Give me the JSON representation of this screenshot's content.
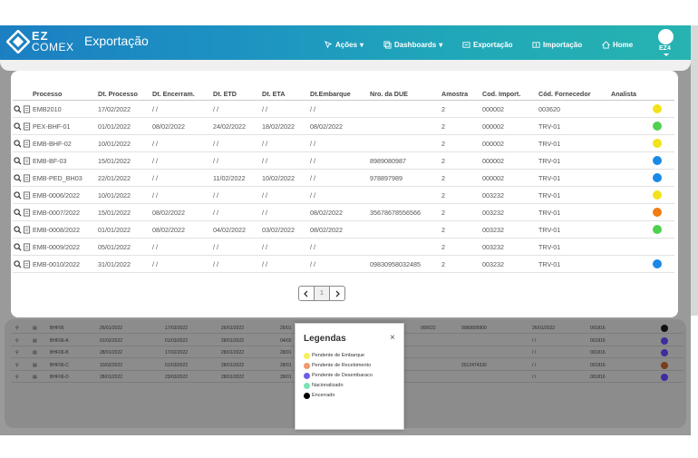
{
  "header": {
    "logo_line1": "EZ",
    "logo_line2": "COMEX",
    "title": "Exportação",
    "nav": [
      {
        "label": "Ações",
        "icon": "cursor-icon",
        "dropdown": true
      },
      {
        "label": "Dashboards",
        "icon": "copy-icon",
        "dropdown": true
      },
      {
        "label": "Exportação",
        "icon": "export-icon",
        "dropdown": false
      },
      {
        "label": "Importação",
        "icon": "import-icon",
        "dropdown": false
      },
      {
        "label": "Home",
        "icon": "home-icon",
        "dropdown": false
      }
    ],
    "user_label": "EZ4"
  },
  "table": {
    "columns": [
      "Processo",
      "Dt. Processo",
      "Dt. Encerram.",
      "Dt. ETD",
      "Dt. ETA",
      "Dt.Embarque",
      "Nro. da DUE",
      "Amostra",
      "Cod. Import.",
      "Cód. Fornecedor",
      "Analista"
    ],
    "rows": [
      {
        "processo": "EMB2010",
        "dt_processo": "17/02/2022",
        "dt_encerram": "/ /",
        "dt_etd": "/ /",
        "dt_eta": "/ /",
        "dt_embarque": "/ /",
        "nro_due": "",
        "amostra": "2",
        "cod_import": "000002",
        "cod_fornecedor": "003620",
        "analista": "",
        "status_color": "#f2e21c"
      },
      {
        "processo": "PEX-BHF-01",
        "dt_processo": "01/01/2022",
        "dt_encerram": "08/02/2022",
        "dt_etd": "24/02/2022",
        "dt_eta": "18/02/2022",
        "dt_embarque": "08/02/2022",
        "nro_due": "",
        "amostra": "2",
        "cod_import": "000002",
        "cod_fornecedor": "TRV-01",
        "analista": "",
        "status_color": "#4fd14f"
      },
      {
        "processo": "EMB-BHF-02",
        "dt_processo": "10/01/2022",
        "dt_encerram": "/ /",
        "dt_etd": "/ /",
        "dt_eta": "/ /",
        "dt_embarque": "/ /",
        "nro_due": "",
        "amostra": "2",
        "cod_import": "000002",
        "cod_fornecedor": "TRV-01",
        "analista": "",
        "status_color": "#f2e21c"
      },
      {
        "processo": "EMB-BF-03",
        "dt_processo": "15/01/2022",
        "dt_encerram": "/ /",
        "dt_etd": "/ /",
        "dt_eta": "/ /",
        "dt_embarque": "/ /",
        "nro_due": "8989080987",
        "amostra": "2",
        "cod_import": "000002",
        "cod_fornecedor": "TRV-01",
        "analista": "",
        "status_color": "#1a8ae6"
      },
      {
        "processo": "EMB-PED_BH03",
        "dt_processo": "22/01/2022",
        "dt_encerram": "/ /",
        "dt_etd": "11/02/2022",
        "dt_eta": "10/02/2022",
        "dt_embarque": "/ /",
        "nro_due": "978897989",
        "amostra": "2",
        "cod_import": "000002",
        "cod_fornecedor": "TRV-01",
        "analista": "",
        "status_color": "#1a8ae6"
      },
      {
        "processo": "EMB-0006/2022",
        "dt_processo": "10/01/2022",
        "dt_encerram": "/ /",
        "dt_etd": "/ /",
        "dt_eta": "/ /",
        "dt_embarque": "/ /",
        "nro_due": "",
        "amostra": "2",
        "cod_import": "003232",
        "cod_fornecedor": "TRV-01",
        "analista": "",
        "status_color": "#f2e21c"
      },
      {
        "processo": "EMB-0007/2022",
        "dt_processo": "15/01/2022",
        "dt_encerram": "08/02/2022",
        "dt_etd": "/ /",
        "dt_eta": "/ /",
        "dt_embarque": "08/02/2022",
        "nro_due": "35678678556566",
        "amostra": "2",
        "cod_import": "003232",
        "cod_fornecedor": "TRV-01",
        "analista": "",
        "status_color": "#f27d12"
      },
      {
        "processo": "EMB-0008/2022",
        "dt_processo": "01/01/2022",
        "dt_encerram": "08/02/2022",
        "dt_etd": "04/02/2022",
        "dt_eta": "03/02/2022",
        "dt_embarque": "08/02/2022",
        "nro_due": "",
        "amostra": "2",
        "cod_import": "003232",
        "cod_fornecedor": "TRV-01",
        "analista": "",
        "status_color": "#4fd14f"
      },
      {
        "processo": "EMB-0009/2022",
        "dt_processo": "05/01/2022",
        "dt_encerram": "/ /",
        "dt_etd": "/ /",
        "dt_eta": "/ /",
        "dt_embarque": "/ /",
        "nro_due": "",
        "amostra": "2",
        "cod_import": "003232",
        "cod_fornecedor": "TRV-01",
        "analista": "",
        "status_color": ""
      },
      {
        "processo": "EMB-0010/2022",
        "dt_processo": "31/01/2022",
        "dt_encerram": "/ /",
        "dt_etd": "/ /",
        "dt_eta": "/ /",
        "dt_embarque": "/ /",
        "nro_due": "09830958032485",
        "amostra": "2",
        "cod_import": "003232",
        "cod_fornecedor": "TRV-01",
        "analista": "",
        "status_color": "#1a8ae6"
      }
    ]
  },
  "pagination": {
    "current_page": "1"
  },
  "background_rows": [
    {
      "processo": "BHF05",
      "dt_processo": "26/01/2022",
      "dt_encerram": "17/03/2022",
      "dt_etd": "26/01/2022",
      "dt_eta": "26/01",
      "extra1": "000022",
      "extra2": "9089899900",
      "extra3": "26/01/2022",
      "extra4": "001816",
      "color": "#111111"
    },
    {
      "processo": "BHF06-A",
      "dt_processo": "01/02/2022",
      "dt_encerram": "01/03/2022",
      "dt_etd": "28/01/2022",
      "dt_eta": "04/02",
      "extra1": "",
      "extra2": "",
      "extra3": "/ /",
      "extra4": "001816",
      "color": "#3d2ea0"
    },
    {
      "processo": "BHF06-B",
      "dt_processo": "28/01/2022",
      "dt_encerram": "17/02/2022",
      "dt_etd": "28/01/2022",
      "dt_eta": "28/01",
      "extra1": "",
      "extra2": "",
      "extra3": "/ /",
      "extra4": "001816",
      "color": "#3d2ea0"
    },
    {
      "processo": "BHF06-C",
      "dt_processo": "10/02/2022",
      "dt_encerram": "01/03/2022",
      "dt_etd": "28/01/2022",
      "dt_eta": "28/01",
      "extra1": "",
      "extra2": "2012474330",
      "extra3": "/ /",
      "extra4": "001816",
      "color": "#7a3e1c"
    },
    {
      "processo": "BHF06-D",
      "dt_processo": "28/01/2022",
      "dt_encerram": "23/03/2022",
      "dt_etd": "28/01/2022",
      "dt_eta": "28/01",
      "extra1": "",
      "extra2": "",
      "extra3": "/ /",
      "extra4": "001816",
      "color": "#3d2ea0"
    }
  ],
  "legend": {
    "title": "Legendas",
    "close": "×",
    "items": [
      {
        "label": "Pendente de Embarque",
        "color": "#f7ef5a"
      },
      {
        "label": "Pendente de Recebimento",
        "color": "#f29a6a"
      },
      {
        "label": "Pendente de Desembaraco",
        "color": "#6d5ee8"
      },
      {
        "label": "Nacionalizado",
        "color": "#7be3b5"
      },
      {
        "label": "Encerrado",
        "color": "#000000"
      }
    ]
  }
}
